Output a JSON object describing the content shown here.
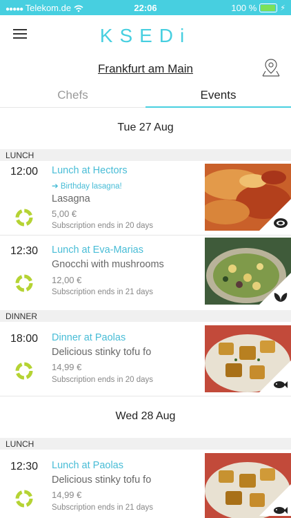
{
  "status": {
    "carrier": "Telekom.de",
    "time": "22:06",
    "battery": "100 %"
  },
  "header": {
    "logo": "KSEDi",
    "city": "Frankfurt am Main"
  },
  "tabs": [
    {
      "label": "Chefs"
    },
    {
      "label": "Events"
    }
  ],
  "active_tab": "Events",
  "colors": {
    "accent": "#47cfe0",
    "ring": "#b5d334"
  },
  "days": [
    {
      "date": "Tue 27 Aug",
      "sections": [
        {
          "label": "LUNCH",
          "events": [
            {
              "time": "12:00",
              "title": "Lunch at Hectors",
              "tag": "➔ Birthday lasagna!",
              "dish": "Lasagna",
              "price": "5,00 €",
              "subscription": "Subscription ends in 20 days",
              "category_icon": "meat-icon"
            },
            {
              "time": "12:30",
              "title": "Lunch at Eva-Marias",
              "dish": "Gnocchi with mushrooms",
              "price": "12,00 €",
              "subscription": "Subscription ends in 21 days",
              "category_icon": "leaf-icon"
            }
          ]
        },
        {
          "label": "DINNER",
          "events": [
            {
              "time": "18:00",
              "title": "Dinner at Paolas",
              "dish": "Delicious stinky tofu fo",
              "price": "14,99 €",
              "subscription": "Subscription ends in 20 days",
              "category_icon": "fish-icon"
            }
          ]
        }
      ]
    },
    {
      "date": "Wed 28 Aug",
      "sections": [
        {
          "label": "LUNCH",
          "events": [
            {
              "time": "12:30",
              "title": "Lunch at Paolas",
              "dish": "Delicious stinky tofu fo",
              "price": "14,99 €",
              "subscription": "Subscription ends in 21 days",
              "category_icon": "fish-icon"
            }
          ]
        }
      ]
    }
  ]
}
